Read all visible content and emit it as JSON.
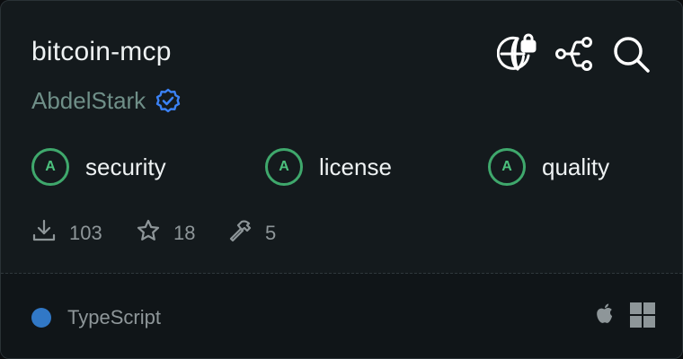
{
  "card": {
    "title": "bitcoin-mcp",
    "author": "AbdelStark",
    "verified_icon": "verified-badge-icon",
    "header_icons": [
      "globe-lock-icon",
      "network-icon",
      "search-icon"
    ]
  },
  "grades": [
    {
      "grade": "A",
      "label": "security"
    },
    {
      "grade": "A",
      "label": "license"
    },
    {
      "grade": "A",
      "label": "quality"
    }
  ],
  "stats": {
    "downloads": "103",
    "stars": "18",
    "tools": "5"
  },
  "footer": {
    "language": "TypeScript",
    "language_color": "#3178c6",
    "platforms": [
      "apple-icon",
      "windows-icon"
    ]
  },
  "colors": {
    "grade_accent": "#3fa86c",
    "verified": "#3b82f6"
  }
}
